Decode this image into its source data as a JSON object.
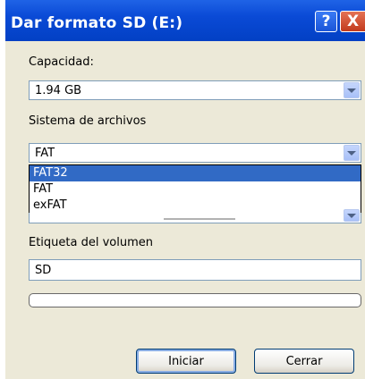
{
  "window": {
    "title": "Dar formato SD (E:)",
    "help_glyph": "?",
    "close_glyph": "X"
  },
  "capacity": {
    "label": "Capacidad:",
    "value": "1.94 GB"
  },
  "filesystem": {
    "label": "Sistema de archivos",
    "value": "FAT",
    "options": [
      "FAT32",
      "FAT",
      "exFAT"
    ],
    "highlighted": "FAT32"
  },
  "volume": {
    "label": "Etiqueta del volumen",
    "value": "SD"
  },
  "progress": {
    "fraction": 0
  },
  "buttons": {
    "start": "Iniciar",
    "close": "Cerrar"
  },
  "colors": {
    "titlebar": "#0a4ad6",
    "selection": "#316ac5",
    "dialog_bg": "#ece9d8"
  }
}
